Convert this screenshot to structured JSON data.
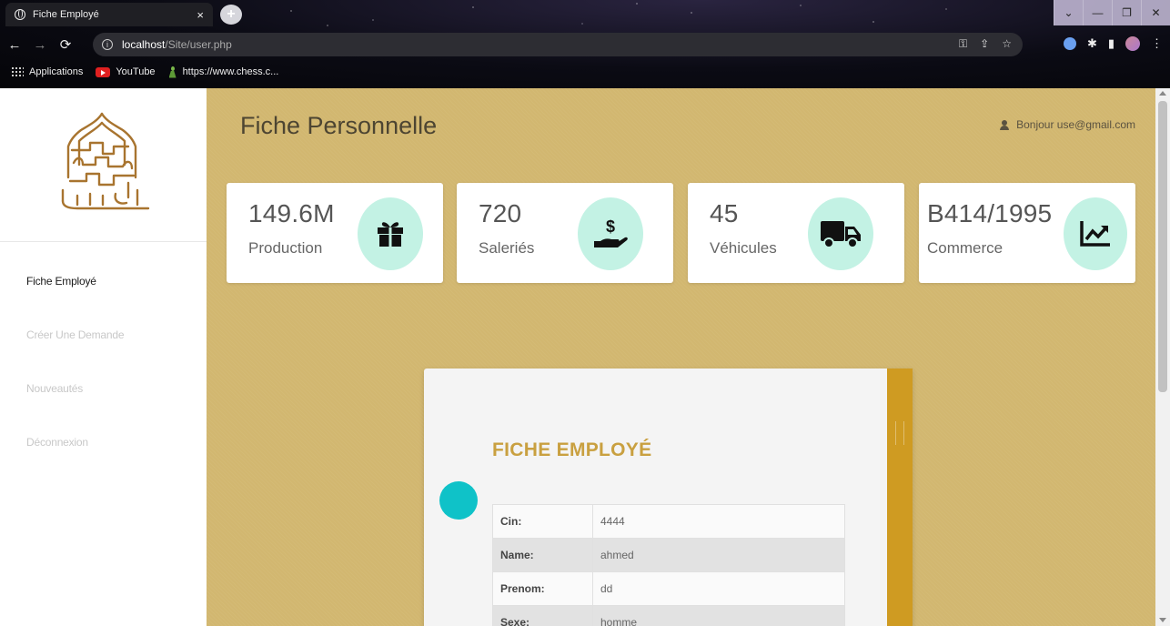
{
  "browser": {
    "tab_title": "Fiche Employé",
    "tab_close": "×",
    "new_tab": "+",
    "url_host": "localhost",
    "url_path": "/Site/user.php",
    "bookmarks": [
      {
        "label": "Applications",
        "icon": "apps-grid-icon"
      },
      {
        "label": "YouTube",
        "icon": "youtube-icon"
      },
      {
        "label": "https://www.chess.c...",
        "icon": "chess-icon"
      }
    ]
  },
  "sidebar": {
    "items": [
      {
        "label": "Fiche Employé",
        "active": true
      },
      {
        "label": "Créer Une Demande",
        "active": false
      },
      {
        "label": "Nouveautés",
        "active": false
      },
      {
        "label": "Déconnexion",
        "active": false
      }
    ]
  },
  "header": {
    "title": "Fiche Personnelle",
    "greeting": "Bonjour use@gmail.com"
  },
  "stats": [
    {
      "value": "149.6M",
      "label": "Production",
      "icon": "gift-icon"
    },
    {
      "value": "720",
      "label": "Saleriés",
      "icon": "hand-dollar-icon"
    },
    {
      "value": "45",
      "label": "Véhicules",
      "icon": "truck-icon"
    },
    {
      "value": "B414/1995",
      "label": "Commerce",
      "icon": "chart-line-icon"
    }
  ],
  "profile": {
    "heading": "FICHE EMPLOYÉ",
    "rows": [
      {
        "key": "Cin:",
        "value": "4444"
      },
      {
        "key": "Name:",
        "value": "ahmed"
      },
      {
        "key": "Prenom:",
        "value": "dd"
      },
      {
        "key": "Sexe:",
        "value": "homme"
      }
    ]
  },
  "colors": {
    "main_bg": "#d2b770",
    "accent_gold": "#cf9b22",
    "heading_gold": "#c9a040",
    "icon_circle": "#c3f2e4",
    "dot_cyan": "#0fc2c8"
  }
}
